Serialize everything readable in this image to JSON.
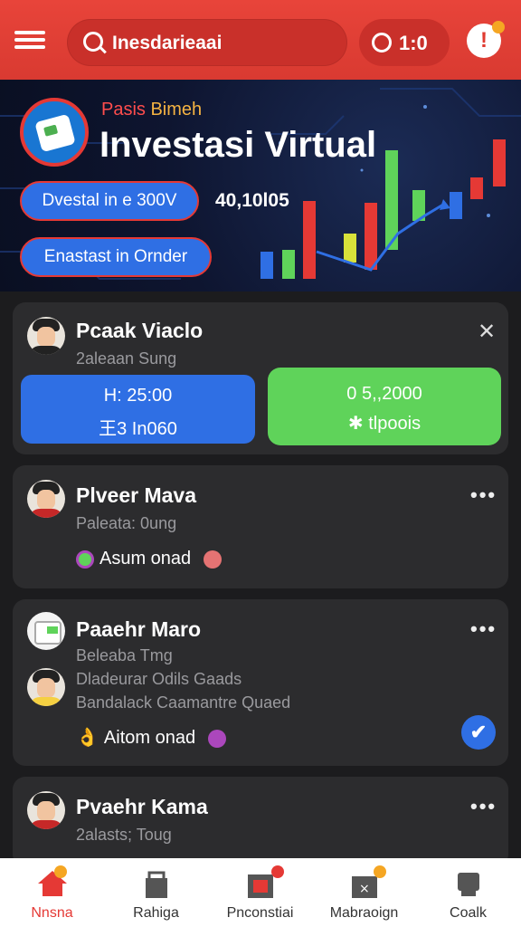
{
  "topbar": {
    "search_text": "Inesdarieaai",
    "timer_text": "1:0",
    "alert_symbol": "!"
  },
  "banner": {
    "subtitle_part1": "Pasis",
    "subtitle_part2": "Bimeh",
    "title": "Investasi Virtual",
    "pill1_label": "Dvestal in e 300V",
    "pill1_value": "40,10l05",
    "pill2_label": "Enastast in Ornder"
  },
  "cards": [
    {
      "name": "Pcaak Viaclo",
      "subtitle": "2aleaan Sung",
      "blue_line1": "H: 25:00",
      "blue_line2": "王3 In060",
      "green_line1": "0 5,,2000",
      "green_line2": "tlpoois"
    },
    {
      "name": "Plveer Mava",
      "subtitle": "Paleata: 0ung",
      "tag": "Asum onad"
    },
    {
      "name": "Paaehr Maro",
      "subtitle": "Beleaba Tmg",
      "line1": "Dladeurar Odils Gaads",
      "line2": "Bandalack Caamantre Quaed",
      "tag": "Aitom onad"
    },
    {
      "name": "Pvaehr Kama",
      "subtitle": "2alasts; Toug"
    }
  ],
  "bottom_nav": [
    {
      "label": "Nnsna",
      "color": "#e53935"
    },
    {
      "label": "Rahiga",
      "color": "#333333"
    },
    {
      "label": "Pnconstiai",
      "color": "#333333"
    },
    {
      "label": "Mabraoign",
      "color": "#333333"
    },
    {
      "label": "Coalk",
      "color": "#333333"
    }
  ],
  "colors": {
    "accent_red": "#e53935",
    "blue": "#2f6fe4",
    "green": "#5fd35a"
  },
  "icons": [
    "menu-icon",
    "search-icon",
    "timer-icon",
    "alert-icon",
    "close-icon",
    "more-icon",
    "check-icon",
    "home-icon",
    "trophy-icon",
    "calendar-icon",
    "briefcase-icon",
    "chat-icon"
  ]
}
